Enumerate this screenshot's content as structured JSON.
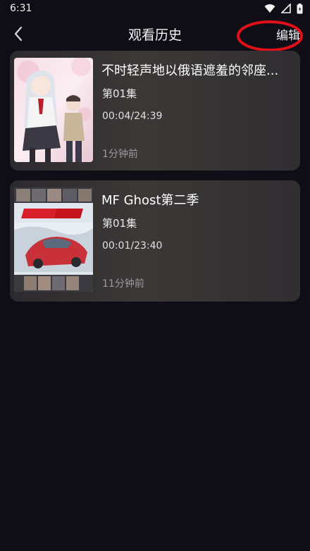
{
  "status_bar": {
    "time": "6:31"
  },
  "header": {
    "title": "观看历史",
    "edit_label": "编辑"
  },
  "history": [
    {
      "title": "不时轻声地以俄语遮羞的邻座...",
      "episode": "第01集",
      "progress": "00:04/24:39",
      "ago": "1分钟前",
      "cover_icon": "anime-cover-girl-school"
    },
    {
      "title": "MF Ghost第二季",
      "episode": "第01集",
      "progress": "00:01/23:40",
      "ago": "11分钟前",
      "cover_icon": "anime-cover-race-car"
    }
  ],
  "colors": {
    "background": "#0f0e16",
    "card": "#353234",
    "annotation": "#e0101a"
  }
}
